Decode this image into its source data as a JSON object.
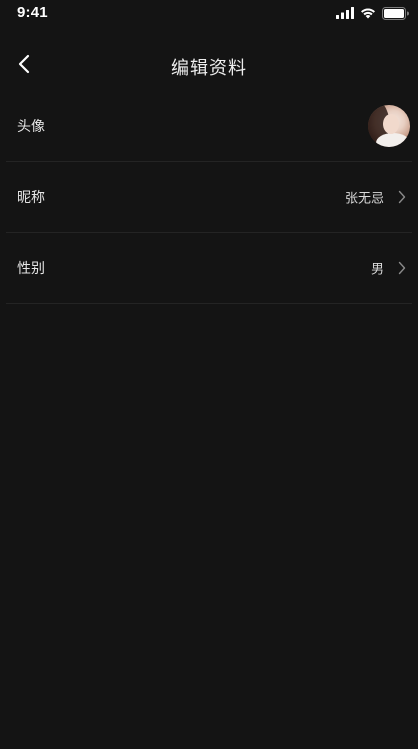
{
  "status_bar": {
    "time": "9:41"
  },
  "nav": {
    "title": "编辑资料"
  },
  "rows": [
    {
      "label": "头像",
      "value": ""
    },
    {
      "label": "昵称",
      "value": "张无忌"
    },
    {
      "label": "性别",
      "value": "男"
    }
  ],
  "colors": {
    "background": "#141414",
    "divider": "#242424",
    "text": "#e6e6e6"
  },
  "icons": {
    "back": "chevron-left-icon",
    "row_arrow": "chevron-right-icon",
    "signal": "cellular-signal-icon",
    "wifi": "wifi-icon",
    "battery": "battery-icon"
  }
}
